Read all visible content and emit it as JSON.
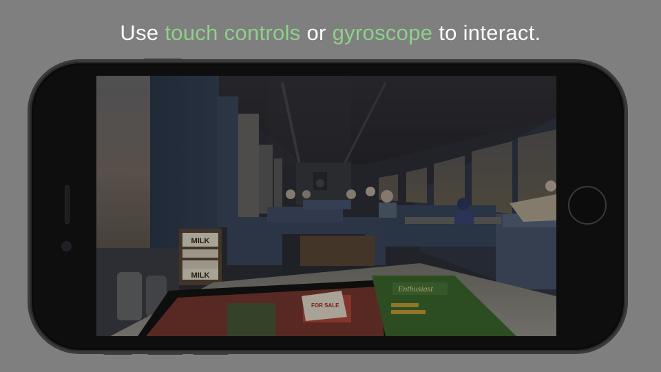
{
  "headline": {
    "prefix": "Use ",
    "accent1": "touch controls",
    "middle": " or ",
    "accent2": "gyroscope",
    "suffix": " to interact."
  },
  "scene": {
    "milk_box_lines": [
      "MILK",
      "MILK"
    ],
    "magazine_title": "Enthusiast",
    "newspaper_snippet": "FOR SALE"
  },
  "colors": {
    "background": "#7f7f7f",
    "accent": "#8fd18a",
    "phone": "#0e0e0f"
  }
}
